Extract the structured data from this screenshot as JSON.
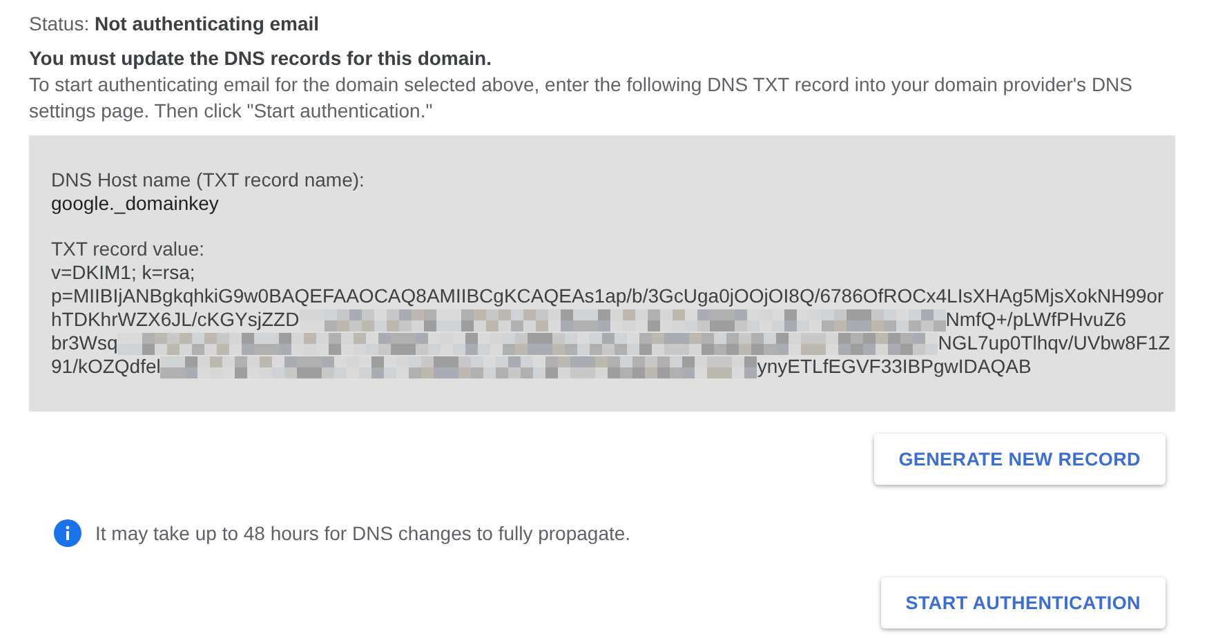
{
  "status": {
    "label": "Status:",
    "value": "Not authenticating email"
  },
  "notice": {
    "heading": "You must update the DNS records for this domain.",
    "body": "To start authenticating email for the domain selected above, enter the following DNS TXT record into your domain provider's DNS settings page. Then click \"Start authentication.\""
  },
  "record": {
    "host_label": "DNS Host name (TXT record name):",
    "host_value": "google._domainkey",
    "value_label": "TXT record value:",
    "value_lines": [
      {
        "start": "v=DKIM1; k=rsa;",
        "redacted": false
      },
      {
        "start": "p=MIIBIjANBgkqhkiG9w0BAQEFAAOCAQ8AMIIBCgKCAQEAs1ap/b/3GcUga0jOOjOI8Q/6786OfROCx4LIsXHAg5MjsXokNH99or",
        "redacted": false
      },
      {
        "start": "hTDKhrWZX6JL/cKGYsjZZD",
        "redacted": true,
        "end": "NmfQ+/pLWfPHvuZ6"
      },
      {
        "start": "br3Wsq",
        "redacted": true,
        "end": "NGL7up0Tlhqv/UVbw8F1Z"
      },
      {
        "start": "91/kOZQdfel",
        "redacted": true,
        "end": "ynyETLfEGVF33IBPgwIDAQAB"
      }
    ]
  },
  "generate_button": "GENERATE NEW RECORD",
  "info": "It may take up to 48 hours for DNS changes to fully propagate.",
  "start_button": "START AUTHENTICATION"
}
